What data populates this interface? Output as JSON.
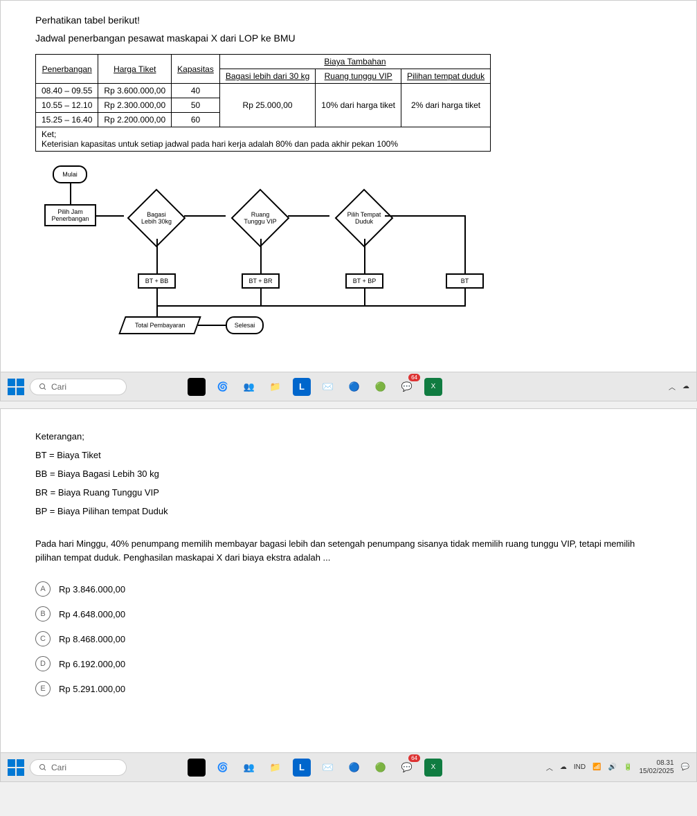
{
  "intro": "Perhatikan tabel berikut!",
  "subtitle": "Jadwal penerbangan pesawat maskapai X dari LOP ke BMU",
  "table": {
    "headers": {
      "penerbangan": "Penerbangan",
      "harga": "Harga Tiket",
      "kapasitas": "Kapasitas",
      "biaya_tambahan": "Biaya Tambahan",
      "bagasi": "Bagasi lebih dari 30 kg",
      "ruang": "Ruang tunggu VIP",
      "tempat": "Pilihan tempat duduk"
    },
    "rows": [
      {
        "waktu": "08.40 – 09.55",
        "harga": "Rp 3.600.000,00",
        "kap": "40"
      },
      {
        "waktu": "10.55 – 12.10",
        "harga": "Rp 2.300.000,00",
        "kap": "50"
      },
      {
        "waktu": "15.25 – 16.40",
        "harga": "Rp 2.200.000,00",
        "kap": "60"
      }
    ],
    "extras": {
      "bagasi": "Rp 25.000,00",
      "ruang": "10% dari harga tiket",
      "tempat": "2% dari harga tiket"
    },
    "ket_label": "Ket;",
    "ket_text": "Keterisian kapasitas untuk setiap jadwal pada hari kerja adalah 80% dan pada akhir pekan 100%"
  },
  "flowchart": {
    "mulai": "Mulai",
    "pilih_jam": "Pilih Jam Penerbangan",
    "bagasi": "Bagasi Lebih 30kg",
    "ruang": "Ruang Tunggu VIP",
    "tempat": "Pilih Tempat Duduk",
    "bt_bb": "BT + BB",
    "bt_br": "BT + BR",
    "bt_bp": "BT + BP",
    "bt": "BT",
    "total": "Total Pembayaran",
    "selesai": "Selesai"
  },
  "keterangan": {
    "title": "Keterangan;",
    "bt": "BT = Biaya Tiket",
    "bb": "BB = Biaya Bagasi Lebih 30 kg",
    "br": "BR = Biaya Ruang Tunggu VIP",
    "bp": "BP = Biaya Pilihan tempat Duduk"
  },
  "question": "Pada hari Minggu, 40% penumpang memilih membayar bagasi lebih dan setengah penumpang sisanya tidak memilih ruang tunggu VIP, tetapi memilih pilihan tempat duduk. Penghasilan maskapai X dari biaya ekstra adalah ...",
  "options": {
    "A": "Rp 3.846.000,00",
    "B": "Rp 4.648.000,00",
    "C": "Rp 8.468.000,00",
    "D": "Rp 6.192.000,00",
    "E": "Rp 5.291.000,00"
  },
  "taskbar": {
    "search": "Cari",
    "ind": "IND",
    "time": "08.31",
    "date": "15/02/2025",
    "badge": "64"
  }
}
